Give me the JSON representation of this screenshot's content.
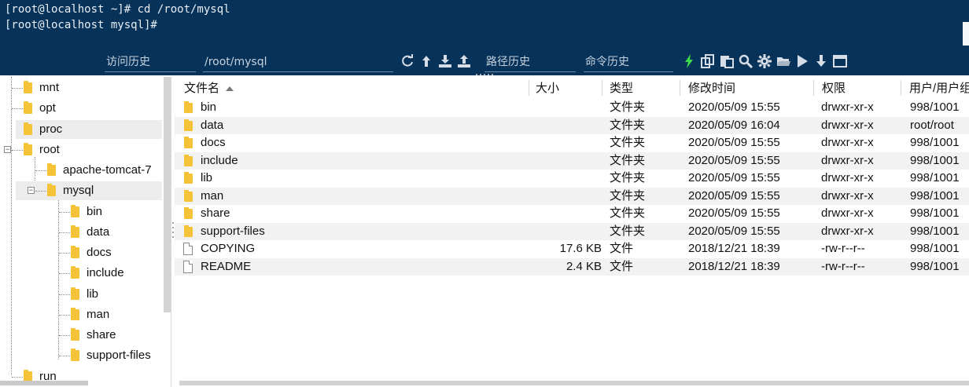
{
  "terminal": {
    "lines": [
      "[root@localhost ~]# cd /root/mysql",
      "[root@localhost mysql]#"
    ]
  },
  "toolbar": {
    "history_label": "访问历史",
    "path_value": "/root/mysql",
    "path_history_label": "路径历史",
    "command_history_label": "命令历史",
    "icons": [
      "refresh-icon",
      "up-icon",
      "download-icon",
      "upload-icon",
      "bolt-icon",
      "copy-icon",
      "paste-icon",
      "search-icon",
      "gear-icon",
      "folder-open-icon",
      "play-icon",
      "arrow-down-icon",
      "window-icon"
    ]
  },
  "tree": {
    "items": [
      {
        "label": "mnt"
      },
      {
        "label": "opt"
      },
      {
        "label": "proc"
      },
      {
        "label": "root"
      },
      {
        "label": "apache-tomcat-7"
      },
      {
        "label": "mysql"
      },
      {
        "label": "bin"
      },
      {
        "label": "data"
      },
      {
        "label": "docs"
      },
      {
        "label": "include"
      },
      {
        "label": "lib"
      },
      {
        "label": "man"
      },
      {
        "label": "share"
      },
      {
        "label": "support-files"
      },
      {
        "label": "run"
      }
    ],
    "toggle_minus": "−"
  },
  "list": {
    "columns": {
      "name": "文件名",
      "size": "大小",
      "type": "类型",
      "modified": "修改时间",
      "perm": "权限",
      "owner": "用户/用户组"
    },
    "rows": [
      {
        "name": "bin",
        "size": "",
        "type": "文件夹",
        "modified": "2020/05/09 15:55",
        "perm": "drwxr-xr-x",
        "owner": "998/1001",
        "kind": "folder"
      },
      {
        "name": "data",
        "size": "",
        "type": "文件夹",
        "modified": "2020/05/09 16:04",
        "perm": "drwxr-xr-x",
        "owner": "root/root",
        "kind": "folder"
      },
      {
        "name": "docs",
        "size": "",
        "type": "文件夹",
        "modified": "2020/05/09 15:55",
        "perm": "drwxr-xr-x",
        "owner": "998/1001",
        "kind": "folder"
      },
      {
        "name": "include",
        "size": "",
        "type": "文件夹",
        "modified": "2020/05/09 15:55",
        "perm": "drwxr-xr-x",
        "owner": "998/1001",
        "kind": "folder"
      },
      {
        "name": "lib",
        "size": "",
        "type": "文件夹",
        "modified": "2020/05/09 15:55",
        "perm": "drwxr-xr-x",
        "owner": "998/1001",
        "kind": "folder"
      },
      {
        "name": "man",
        "size": "",
        "type": "文件夹",
        "modified": "2020/05/09 15:55",
        "perm": "drwxr-xr-x",
        "owner": "998/1001",
        "kind": "folder"
      },
      {
        "name": "share",
        "size": "",
        "type": "文件夹",
        "modified": "2020/05/09 15:55",
        "perm": "drwxr-xr-x",
        "owner": "998/1001",
        "kind": "folder"
      },
      {
        "name": "support-files",
        "size": "",
        "type": "文件夹",
        "modified": "2020/05/09 15:55",
        "perm": "drwxr-xr-x",
        "owner": "998/1001",
        "kind": "folder"
      },
      {
        "name": "COPYING",
        "size": "17.6 KB",
        "type": "文件",
        "modified": "2018/12/21 18:39",
        "perm": "-rw-r--r--",
        "owner": "998/1001",
        "kind": "file"
      },
      {
        "name": "README",
        "size": "2.4 KB",
        "type": "文件",
        "modified": "2018/12/21 18:39",
        "perm": "-rw-r--r--",
        "owner": "998/1001",
        "kind": "file"
      }
    ]
  },
  "colors": {
    "terminal_bg": "#07335a",
    "folder": "#f5c338",
    "bolt": "#3ddc4a"
  }
}
